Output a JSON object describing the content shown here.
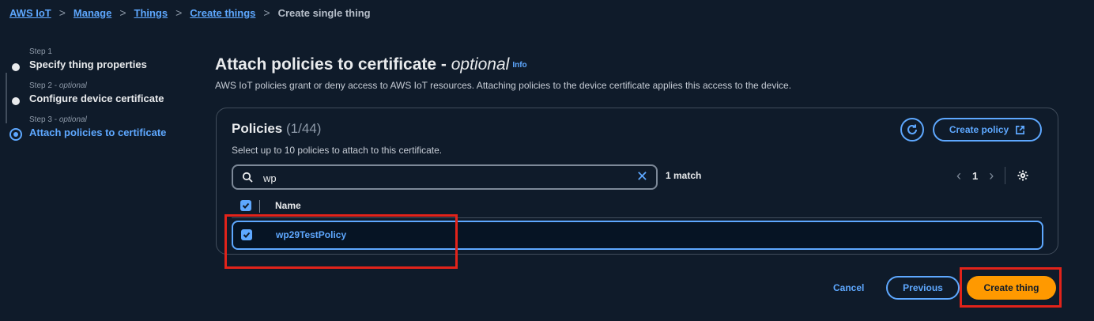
{
  "breadcrumb": {
    "items": [
      "AWS IoT",
      "Manage",
      "Things",
      "Create things"
    ],
    "current": "Create single thing",
    "separator": ">"
  },
  "steps": [
    {
      "label": "Step 1",
      "optional": "",
      "title": "Specify thing properties",
      "state": "completed"
    },
    {
      "label": "Step 2 - ",
      "optional": "optional",
      "title": "Configure device certificate",
      "state": "completed"
    },
    {
      "label": "Step 3 - ",
      "optional": "optional",
      "title": "Attach policies to certificate",
      "state": "active"
    }
  ],
  "main": {
    "title": "Attach policies to certificate - ",
    "title_optional": "optional",
    "info": "Info",
    "description": "AWS IoT policies grant or deny access to AWS IoT resources. Attaching policies to the device certificate applies this access to the device."
  },
  "policies": {
    "title": "Policies",
    "count": "(1/44)",
    "subtitle": "Select up to 10 policies to attach to this certificate.",
    "create_policy": "Create policy",
    "search_value": "wp",
    "match_text": "1 match",
    "page": "1",
    "column_name": "Name",
    "rows": [
      {
        "name": "wp29TestPolicy",
        "checked": true
      }
    ]
  },
  "footer": {
    "cancel": "Cancel",
    "previous": "Previous",
    "create": "Create thing"
  },
  "colors": {
    "background": "#0f1b2a",
    "accent": "#5ea8ff",
    "primary_button": "#ff9900",
    "highlight_box": "#e2231a"
  }
}
